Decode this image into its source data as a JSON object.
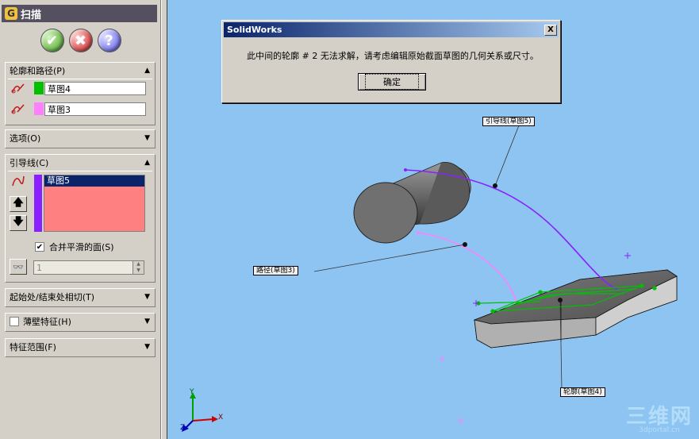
{
  "property_manager": {
    "title": "扫描",
    "buttons": {
      "ok": "✔",
      "cancel": "✖",
      "help": "?"
    },
    "profile_path": {
      "header": "轮廓和路径(P)",
      "profile": "草图4",
      "path": "草图3",
      "profile_color": "#00c000",
      "path_color": "#ff80ff"
    },
    "options": {
      "header": "选项(O)"
    },
    "guide_curves": {
      "header": "引导线(C)",
      "items": [
        "草图5"
      ],
      "merge_label": "合并平滑的面(S)",
      "merge_checked": true,
      "spin_value": "1"
    },
    "tangency": {
      "header": "起始处/结束处相切(T)"
    },
    "thin_feature": {
      "header": "薄壁特征(H)",
      "checked": false
    },
    "feature_scope": {
      "header": "特征范围(F)"
    }
  },
  "dialog": {
    "title": "SolidWorks",
    "message": "此中间的轮廓 # 2 无法求解，请考虑编辑原始截面草图的几何关系或尺寸。",
    "ok_label": "确定",
    "close_label": "X"
  },
  "viewport": {
    "callouts": {
      "guide": "引导线(草图5)",
      "path": "路径(草图3)",
      "profile": "轮廓(草图4)"
    },
    "triad": {
      "x": "X",
      "y": "Y",
      "z": "Z"
    },
    "watermark": {
      "big": "三维网",
      "small": "3dportal.cn"
    }
  }
}
